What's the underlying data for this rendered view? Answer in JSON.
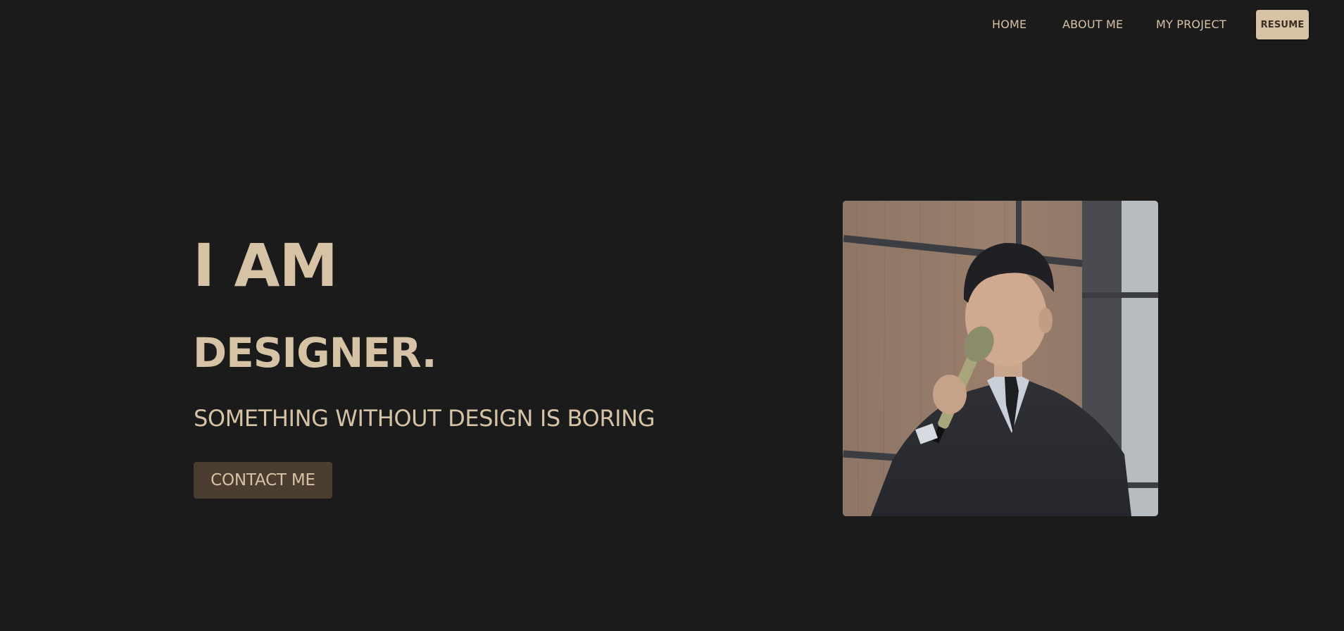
{
  "nav": {
    "links": [
      {
        "label": "HOME"
      },
      {
        "label": "ABOUT ME"
      },
      {
        "label": "MY PROJECT"
      }
    ],
    "resume_label": "RESUME"
  },
  "hero": {
    "title": "I AM",
    "role": "DESIGNER.",
    "tagline": "SOMETHING WITHOUT DESIGN IS BORING",
    "contact_label": "CONTACT ME"
  },
  "photo": {
    "subject": "man in dark suit speaking into a microphone"
  },
  "colors": {
    "background": "#1b1b1b",
    "accent": "#d6c2a4",
    "button_dark": "#4b3d30",
    "button_text_dark": "#3a2e22"
  }
}
